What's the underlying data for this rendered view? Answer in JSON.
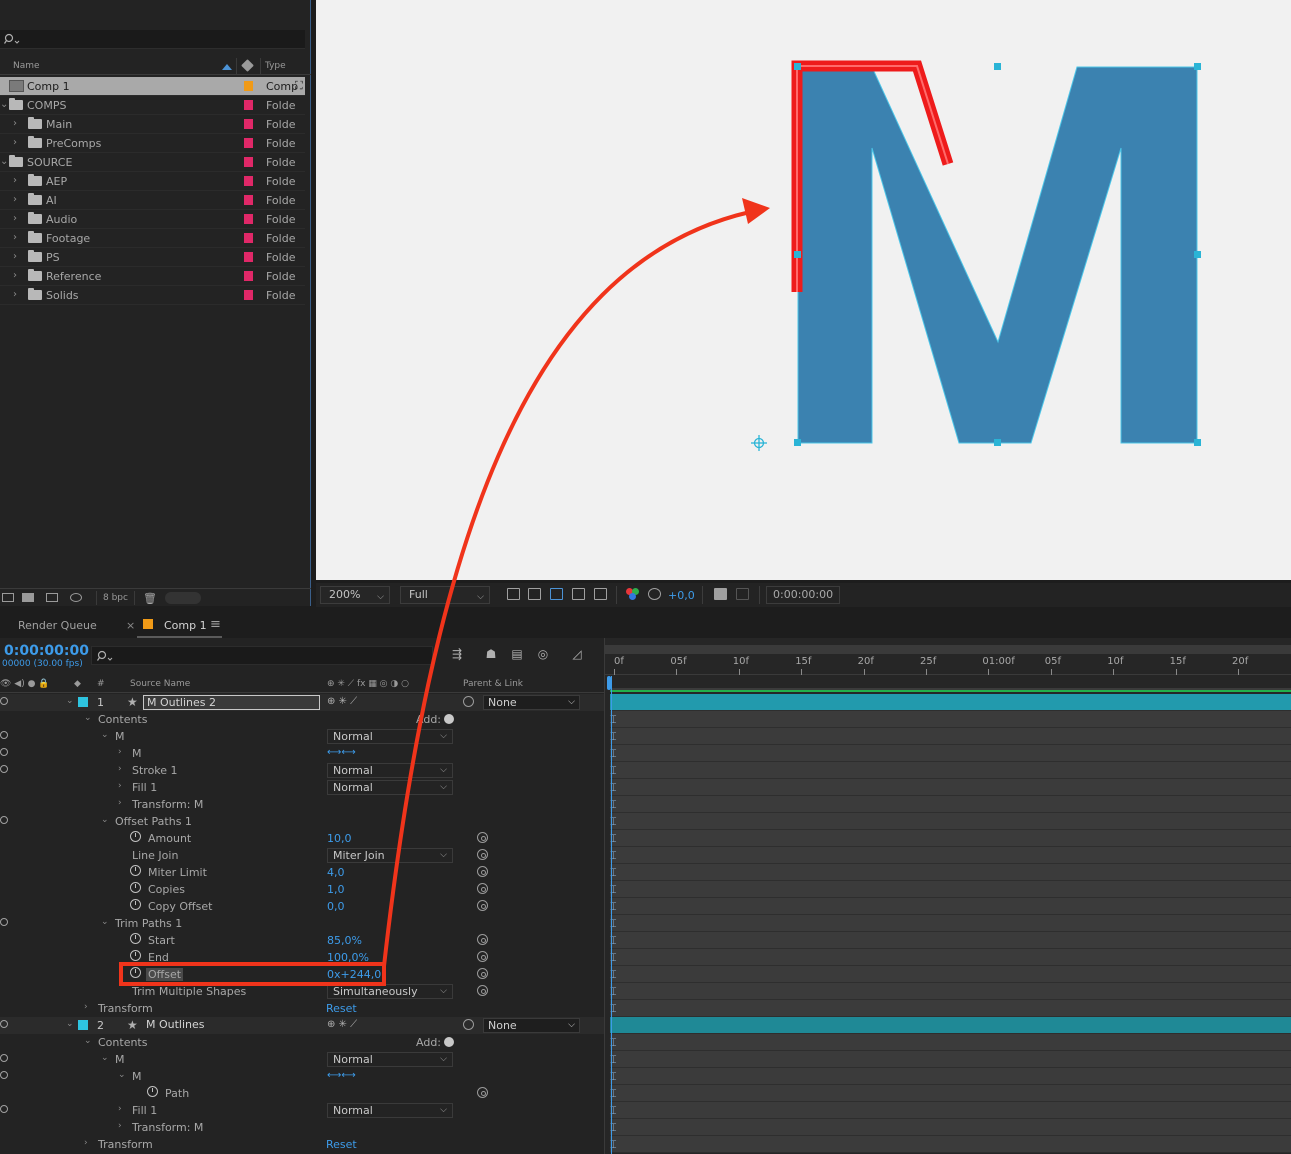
{
  "project": {
    "header": {
      "name": "Name",
      "type": "Type"
    },
    "items": [
      {
        "label": "Comp 1",
        "type": "Comp",
        "kind": "comp",
        "selected": true
      },
      {
        "label": "COMPS",
        "type": "Folde",
        "kind": "folder",
        "level": 0
      },
      {
        "label": "Main",
        "type": "Folde",
        "kind": "folder",
        "level": 1
      },
      {
        "label": "PreComps",
        "type": "Folde",
        "kind": "folder",
        "level": 1
      },
      {
        "label": "SOURCE",
        "type": "Folde",
        "kind": "folder",
        "level": 0
      },
      {
        "label": "AEP",
        "type": "Folde",
        "kind": "folder",
        "level": 1
      },
      {
        "label": "AI",
        "type": "Folde",
        "kind": "folder",
        "level": 1
      },
      {
        "label": "Audio",
        "type": "Folde",
        "kind": "folder",
        "level": 1
      },
      {
        "label": "Footage",
        "type": "Folde",
        "kind": "folder",
        "level": 1
      },
      {
        "label": "PS",
        "type": "Folde",
        "kind": "folder",
        "level": 1
      },
      {
        "label": "Reference",
        "type": "Folde",
        "kind": "folder",
        "level": 1
      },
      {
        "label": "Solids",
        "type": "Folde",
        "kind": "folder",
        "level": 1
      }
    ],
    "footer": {
      "bpc": "8 bpc"
    }
  },
  "viewer_bar": {
    "zoom": "200%",
    "resolution": "Full",
    "exposure": "+0,0",
    "timecode": "0:00:00:00"
  },
  "tabs": {
    "render_queue": "Render Queue",
    "close": "×",
    "comp": "Comp 1",
    "menu": "≡"
  },
  "timeline": {
    "current_time": "0:00:00:00",
    "fps": "00000 (30.00 fps)",
    "columns": {
      "num": "#",
      "source_name": "Source Name",
      "parent_link": "Parent & Link"
    },
    "ruler": [
      "0f",
      "05f",
      "10f",
      "15f",
      "20f",
      "25f",
      "01:00f",
      "05f",
      "10f",
      "15f",
      "20f"
    ],
    "add_label": "Add:",
    "reset_label": "Reset",
    "rows": [
      {
        "type": "layer",
        "num": "1",
        "name": "M Outlines 2",
        "parent": "None",
        "boxed": true
      },
      {
        "type": "group",
        "indent": 1,
        "name": "Contents",
        "add": true
      },
      {
        "type": "group",
        "indent": 2,
        "name": "M",
        "drop": "Normal",
        "eye": true
      },
      {
        "type": "group",
        "indent": 3,
        "name": "M",
        "arrows": true,
        "eye": true
      },
      {
        "type": "group",
        "indent": 3,
        "name": "Stroke 1",
        "drop": "Normal",
        "eye": true
      },
      {
        "type": "group",
        "indent": 3,
        "name": "Fill 1",
        "drop": "Normal"
      },
      {
        "type": "group",
        "indent": 3,
        "name": "Transform: M"
      },
      {
        "type": "group",
        "indent": 2,
        "name": "Offset Paths 1",
        "eye": true
      },
      {
        "type": "prop",
        "indent": 3,
        "name": "Amount",
        "value": "10,0"
      },
      {
        "type": "prop-nosw",
        "indent": 3,
        "name": "Line Join",
        "drop": "Miter Join"
      },
      {
        "type": "prop",
        "indent": 3,
        "name": "Miter Limit",
        "value": "4,0"
      },
      {
        "type": "prop",
        "indent": 3,
        "name": "Copies",
        "value": "1,0"
      },
      {
        "type": "prop",
        "indent": 3,
        "name": "Copy Offset",
        "value": "0,0"
      },
      {
        "type": "group",
        "indent": 2,
        "name": "Trim Paths 1",
        "eye": true
      },
      {
        "type": "prop",
        "indent": 3,
        "name": "Start",
        "value": "85,0%"
      },
      {
        "type": "prop",
        "indent": 3,
        "name": "End",
        "value": "100,0%"
      },
      {
        "type": "prop",
        "indent": 3,
        "name": "Offset",
        "value": "0x+244,0°",
        "highlight": true
      },
      {
        "type": "prop-nosw",
        "indent": 3,
        "name": "Trim Multiple Shapes",
        "drop": "Simultaneously"
      },
      {
        "type": "group",
        "indent": 1,
        "name": "Transform",
        "reset": true
      },
      {
        "type": "layer",
        "num": "2",
        "name": "M Outlines",
        "parent": "None"
      },
      {
        "type": "group",
        "indent": 1,
        "name": "Contents",
        "add": true
      },
      {
        "type": "group",
        "indent": 2,
        "name": "M",
        "drop": "Normal",
        "eye": true
      },
      {
        "type": "group",
        "indent": 3,
        "name": "M",
        "arrows": true,
        "eye": true
      },
      {
        "type": "prop",
        "indent": 4,
        "name": "Path",
        "spiral": true
      },
      {
        "type": "group",
        "indent": 3,
        "name": "Fill 1",
        "drop": "Normal",
        "eye": true
      },
      {
        "type": "group",
        "indent": 3,
        "name": "Transform: M"
      },
      {
        "type": "group",
        "indent": 1,
        "name": "Transform",
        "reset": true
      }
    ]
  },
  "colors": {
    "shape_fill": "#3b82b0",
    "stroke_highlight": "#ee1b1b",
    "annotation_arrow": "#f0341b",
    "accent_blue": "#3d9be9",
    "layer_label": "#2ec4e0",
    "folder_label": "#e02868",
    "comp_label": "#f09a17"
  }
}
